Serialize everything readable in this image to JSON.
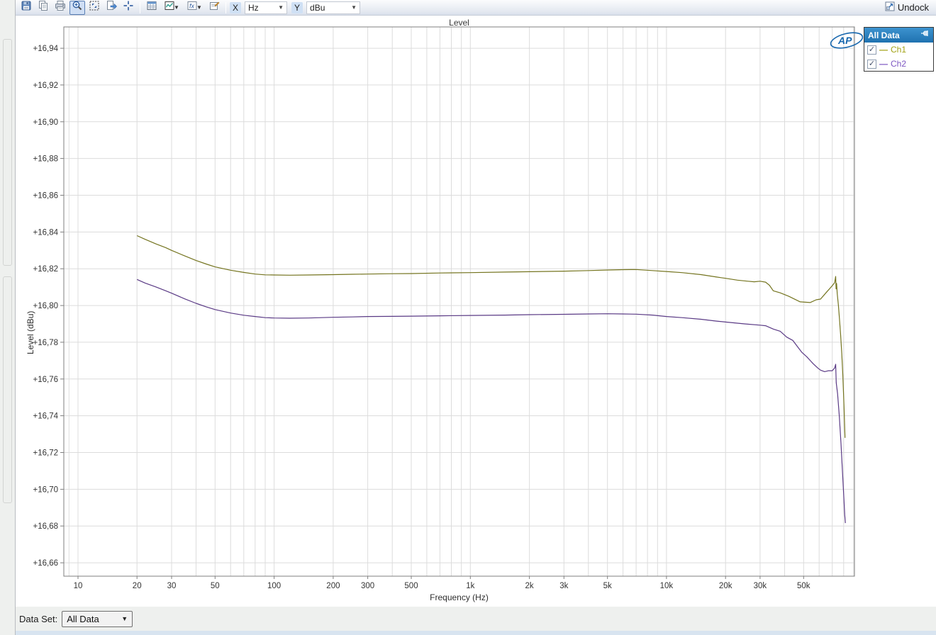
{
  "toolbar": {
    "x_label": "X",
    "x_value": "Hz",
    "y_label": "Y",
    "y_value": "dBu",
    "undock_label": "Undock"
  },
  "legend": {
    "title": "All Data",
    "items": [
      {
        "label": "Ch1",
        "color": "#a2a214",
        "checked": true
      },
      {
        "label": "Ch2",
        "color": "#7d57c2",
        "checked": true
      }
    ]
  },
  "dataset_bar": {
    "label": "Data Set:",
    "value": "All Data"
  },
  "logo_text": "AP",
  "chart_data": {
    "type": "line",
    "title": "Level",
    "xlabel": "Frequency (Hz)",
    "ylabel": "Level (dBu)",
    "x_scale": "log",
    "grid": true,
    "legend_position": "top-right",
    "x_range": [
      8.47,
      90800
    ],
    "y_range": [
      16.6527,
      16.9516
    ],
    "y_ticks": [
      16.94,
      16.92,
      16.9,
      16.88,
      16.86,
      16.84,
      16.82,
      16.8,
      16.78,
      16.76,
      16.74,
      16.72,
      16.7,
      16.68,
      16.66
    ],
    "y_tick_labels": [
      "+16,94",
      "+16,92",
      "+16,90",
      "+16,88",
      "+16,86",
      "+16,84",
      "+16,82",
      "+16,80",
      "+16,78",
      "+16,76",
      "+16,74",
      "+16,72",
      "+16,70",
      "+16,68",
      "+16,66"
    ],
    "x_ticks": [
      10,
      20,
      30,
      50,
      100,
      200,
      300,
      500,
      1000,
      2000,
      3000,
      5000,
      10000,
      20000,
      30000,
      50000
    ],
    "x_tick_labels": [
      "10",
      "20",
      "30",
      "50",
      "100",
      "200",
      "300",
      "500",
      "1k",
      "2k",
      "3k",
      "5k",
      "10k",
      "20k",
      "30k",
      "50k"
    ],
    "series": [
      {
        "name": "Ch1",
        "color": "#74741f",
        "points": [
          [
            20,
            16.838
          ],
          [
            22,
            16.836
          ],
          [
            25,
            16.8335
          ],
          [
            28,
            16.8315
          ],
          [
            30,
            16.83
          ],
          [
            35,
            16.827
          ],
          [
            40,
            16.8245
          ],
          [
            45,
            16.8226
          ],
          [
            50,
            16.821
          ],
          [
            60,
            16.8192
          ],
          [
            70,
            16.818
          ],
          [
            80,
            16.8171
          ],
          [
            90,
            16.8167
          ],
          [
            100,
            16.8166
          ],
          [
            120,
            16.8165
          ],
          [
            150,
            16.8166
          ],
          [
            200,
            16.8168
          ],
          [
            250,
            16.817
          ],
          [
            300,
            16.8171
          ],
          [
            400,
            16.8173
          ],
          [
            500,
            16.8174
          ],
          [
            700,
            16.8177
          ],
          [
            1000,
            16.8179
          ],
          [
            1500,
            16.8182
          ],
          [
            2000,
            16.8184
          ],
          [
            3000,
            16.8187
          ],
          [
            4000,
            16.819
          ],
          [
            5000,
            16.8193
          ],
          [
            6000,
            16.8195
          ],
          [
            7000,
            16.8196
          ],
          [
            8500,
            16.819
          ],
          [
            10000,
            16.8185
          ],
          [
            12000,
            16.8179
          ],
          [
            15000,
            16.8168
          ],
          [
            18000,
            16.8155
          ],
          [
            20000,
            16.8148
          ],
          [
            23000,
            16.8138
          ],
          [
            26000,
            16.8132
          ],
          [
            28000,
            16.8129
          ],
          [
            30000,
            16.8132
          ],
          [
            32000,
            16.8127
          ],
          [
            33500,
            16.811
          ],
          [
            35000,
            16.808
          ],
          [
            38000,
            16.8069
          ],
          [
            42000,
            16.805
          ],
          [
            48000,
            16.802
          ],
          [
            54000,
            16.8016
          ],
          [
            58000,
            16.8031
          ],
          [
            61000,
            16.8035
          ],
          [
            65000,
            16.8069
          ],
          [
            70000,
            16.8108
          ],
          [
            72000,
            16.8125
          ],
          [
            72800,
            16.8158
          ],
          [
            73200,
            16.809
          ],
          [
            73600,
            16.812
          ],
          [
            74200,
            16.8065
          ],
          [
            75200,
            16.8
          ],
          [
            76200,
            16.7925
          ],
          [
            77200,
            16.784
          ],
          [
            78200,
            16.774
          ],
          [
            79200,
            16.762
          ],
          [
            80300,
            16.746
          ],
          [
            81300,
            16.728
          ]
        ]
      },
      {
        "name": "Ch2",
        "color": "#5a3a85",
        "points": [
          [
            20,
            16.8142
          ],
          [
            22,
            16.8122
          ],
          [
            25,
            16.8101
          ],
          [
            28,
            16.808
          ],
          [
            30,
            16.8067
          ],
          [
            35,
            16.8036
          ],
          [
            40,
            16.8012
          ],
          [
            45,
            16.7993
          ],
          [
            50,
            16.7978
          ],
          [
            60,
            16.7959
          ],
          [
            70,
            16.7947
          ],
          [
            80,
            16.794
          ],
          [
            90,
            16.7934
          ],
          [
            100,
            16.7932
          ],
          [
            120,
            16.7931
          ],
          [
            150,
            16.7932
          ],
          [
            200,
            16.7936
          ],
          [
            250,
            16.7938
          ],
          [
            300,
            16.794
          ],
          [
            400,
            16.7941
          ],
          [
            500,
            16.7942
          ],
          [
            700,
            16.7944
          ],
          [
            1000,
            16.7946
          ],
          [
            1500,
            16.7948
          ],
          [
            2000,
            16.795
          ],
          [
            3000,
            16.7952
          ],
          [
            4000,
            16.7954
          ],
          [
            5000,
            16.7955
          ],
          [
            6000,
            16.7954
          ],
          [
            7000,
            16.7953
          ],
          [
            8500,
            16.7948
          ],
          [
            10000,
            16.794
          ],
          [
            12000,
            16.7934
          ],
          [
            15000,
            16.7925
          ],
          [
            18000,
            16.7915
          ],
          [
            20000,
            16.791
          ],
          [
            25000,
            16.79
          ],
          [
            30000,
            16.7893
          ],
          [
            32000,
            16.789
          ],
          [
            35000,
            16.7872
          ],
          [
            38000,
            16.786
          ],
          [
            41000,
            16.7828
          ],
          [
            44000,
            16.781
          ],
          [
            47000,
            16.777
          ],
          [
            49000,
            16.7745
          ],
          [
            52000,
            16.772
          ],
          [
            56000,
            16.7683
          ],
          [
            59000,
            16.766
          ],
          [
            61000,
            16.7648
          ],
          [
            64000,
            16.764
          ],
          [
            67000,
            16.7645
          ],
          [
            70000,
            16.7645
          ],
          [
            72000,
            16.766
          ],
          [
            72800,
            16.768
          ],
          [
            73300,
            16.758
          ],
          [
            74500,
            16.752
          ],
          [
            76000,
            16.74
          ],
          [
            77500,
            16.725
          ],
          [
            79000,
            16.708
          ],
          [
            80200,
            16.695
          ],
          [
            81000,
            16.686
          ],
          [
            81600,
            16.6816
          ]
        ]
      }
    ]
  }
}
